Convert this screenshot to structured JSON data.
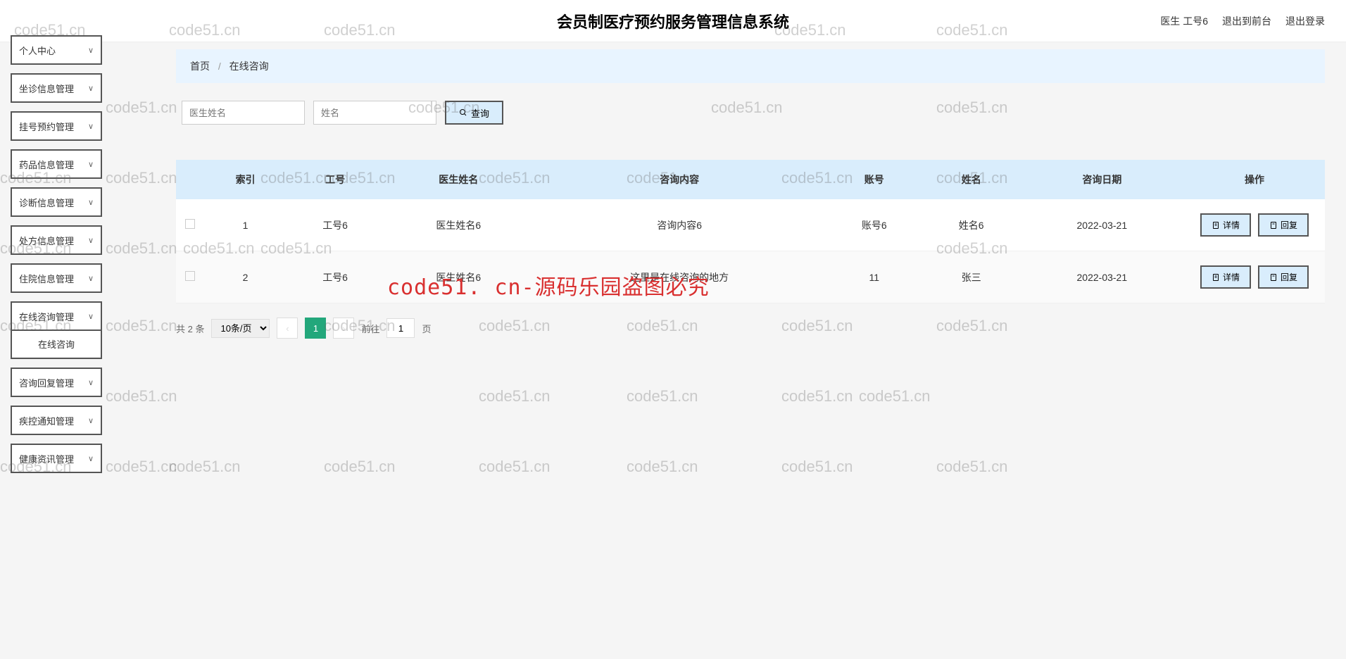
{
  "header": {
    "title": "会员制医疗预约服务管理信息系统",
    "user": "医生 工号6",
    "btn_front": "退出到前台",
    "btn_logout": "退出登录"
  },
  "sidebar": {
    "items": [
      {
        "label": "个人中心"
      },
      {
        "label": "坐诊信息管理"
      },
      {
        "label": "挂号预约管理"
      },
      {
        "label": "药品信息管理"
      },
      {
        "label": "诊断信息管理"
      },
      {
        "label": "处方信息管理"
      },
      {
        "label": "住院信息管理"
      },
      {
        "label": "在线咨询管理",
        "sub": [
          "在线咨询"
        ]
      },
      {
        "label": "咨询回复管理"
      },
      {
        "label": "疾控通知管理"
      },
      {
        "label": "健康资讯管理"
      }
    ]
  },
  "breadcrumb": {
    "home": "首页",
    "current": "在线咨询"
  },
  "filters": {
    "ph_doctor": "医生姓名",
    "ph_name": "姓名",
    "btn_search": "查询"
  },
  "table": {
    "headers": [
      "索引",
      "工号",
      "医生姓名",
      "咨询内容",
      "账号",
      "姓名",
      "咨询日期",
      "操作"
    ],
    "rows": [
      {
        "idx": "1",
        "gh": "工号6",
        "dname": "医生姓名6",
        "content": "咨询内容6",
        "acct": "账号6",
        "name": "姓名6",
        "date": "2022-03-21"
      },
      {
        "idx": "2",
        "gh": "工号6",
        "dname": "医生姓名6",
        "content": "这里是在线咨询的地方",
        "acct": "11",
        "name": "张三",
        "date": "2022-03-21"
      }
    ],
    "btn_detail": "详情",
    "btn_reply": "回复"
  },
  "pagination": {
    "total": "共 2 条",
    "per_page": "10条/页",
    "current": "1",
    "goto_prefix": "前往",
    "goto_suffix": "页",
    "goto_value": "1"
  },
  "watermark": "code51.cn",
  "watermark_red": "code51. cn-源码乐园盗图必究"
}
